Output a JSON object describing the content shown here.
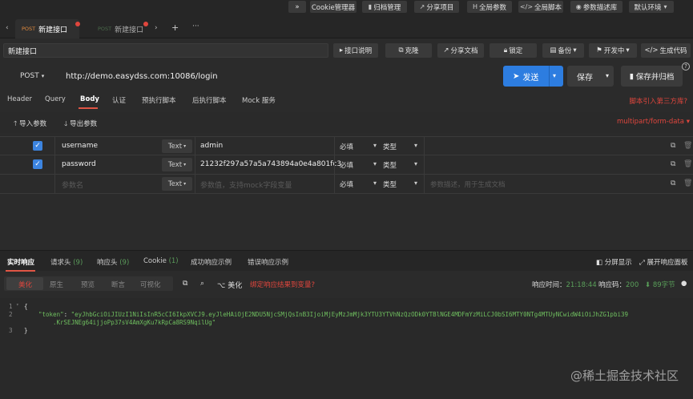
{
  "top_toolbar": {
    "expand": "»",
    "cookie": "Cookie管理器",
    "archive": "归档管理",
    "share_project": "分享项目",
    "global_params": "全局参数",
    "global_script": "全局脚本",
    "param_library": "参数描述库",
    "env": "默认环境"
  },
  "tabs": [
    {
      "method": "POST",
      "label": "新建接口"
    },
    {
      "method": "POST",
      "label": "新建接口"
    }
  ],
  "tab_controls": {
    "next": "›",
    "add": "+",
    "more": "···"
  },
  "api_name": "新建接口",
  "name_bar": {
    "doc": "接口说明",
    "clone": "克隆",
    "share_doc": "分享文档",
    "lock": "锁定",
    "backup": "备份",
    "status": "开发中",
    "gen_code": "生成代码"
  },
  "request": {
    "method": "POST",
    "url": "http://demo.easydss.com:10086/login",
    "send": "发送",
    "save": "保存",
    "save_archive": "保存并归档"
  },
  "request_tabs": [
    "Header",
    "Query",
    "Body",
    "认证",
    "预执行脚本",
    "后执行脚本",
    "Mock 服务"
  ],
  "script_link": "脚本引入第三方库?",
  "import_params": "导入参数",
  "export_params": "导出参数",
  "body_mode": "multipart/form-data",
  "params": [
    {
      "key": "username",
      "type": "Text",
      "value": "admin",
      "required": "必填",
      "type_col": "类型",
      "desc": ""
    },
    {
      "key": "password",
      "type": "Text",
      "value": "21232f297a57a5a743894a0e4a801fc3",
      "required": "必填",
      "type_col": "类型",
      "desc": ""
    }
  ],
  "param_placeholder": {
    "key": "参数名",
    "type": "Text",
    "value": "参数值，支持mock字段变量",
    "required": "必填",
    "type_col": "类型",
    "desc": "参数描述，用于生成文档"
  },
  "response_tabs": {
    "realtime": "实时响应",
    "req_header": "请求头",
    "req_header_count": "(9)",
    "resp_header": "响应头",
    "resp_header_count": "(9)",
    "cookie": "Cookie",
    "cookie_count": "(1)",
    "success_example": "成功响应示例",
    "error_example": "错误响应示例",
    "split": "分屏显示",
    "expand_panel": "展开响应面板"
  },
  "response_toolbar": {
    "formats": [
      "美化",
      "原生",
      "预览",
      "断言",
      "可视化"
    ],
    "beautify": "美化",
    "bind_var": "绑定响应结果到变量?",
    "time_label": "响应时间：",
    "time_value": "21:18:44",
    "code_label": "响应码：",
    "code_value": "200",
    "size_value": "89",
    "size_unit": "字节"
  },
  "code_lines": [
    {
      "n": "1",
      "text": "{"
    },
    {
      "n": "2",
      "key": "\"token\"",
      "val1": "\"eyJhbGciOiJIUzI1NiIsInR5cCI6IkpXVCJ9.eyJleHAiOjE2NDU5NjcSMjQsInB3IjoiMjEyMzJmMjk3YTU3YTVhNzQzODk0YTBlNGE4MDFmYzMiLCJ0bSI6MTY0NTg4MTUyNCwidW4iOiJhZG1pbi39",
      "val2": ".KrSEJNEg64ijjoPp37sV4AmXgKu7kRpCa8RS9NqilUg\""
    },
    {
      "n": "3",
      "text": "}"
    }
  ],
  "watermark": "@稀土掘金技术社区"
}
